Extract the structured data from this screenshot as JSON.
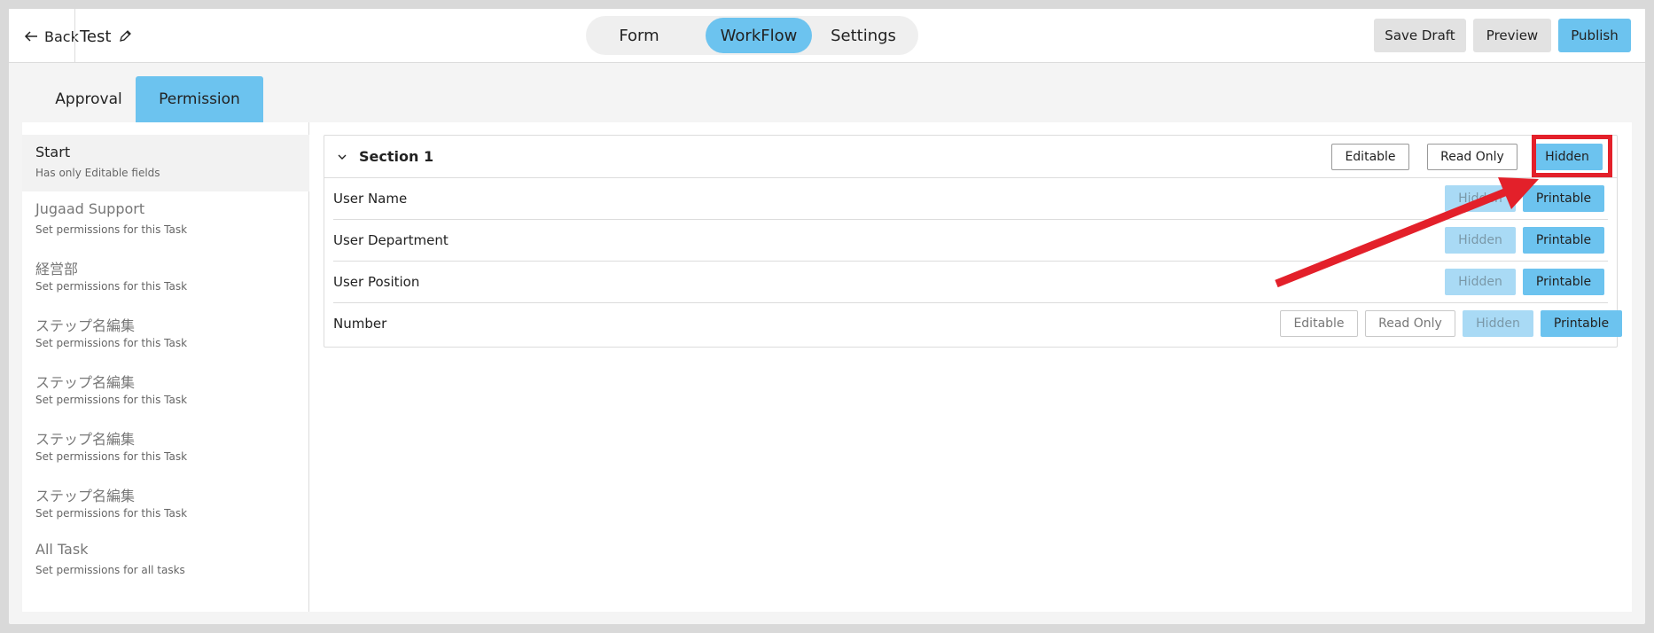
{
  "header": {
    "back_label": "Back",
    "title": "Test",
    "segments": [
      {
        "label": "Form"
      },
      {
        "label": "WorkFlow"
      },
      {
        "label": "Settings"
      }
    ],
    "save_draft_label": "Save Draft",
    "preview_label": "Preview",
    "publish_label": "Publish"
  },
  "tabs": [
    {
      "label": "Approval"
    },
    {
      "label": "Permission"
    }
  ],
  "sidebar": {
    "items": [
      {
        "title": "Start",
        "subtitle": "Has only Editable fields"
      },
      {
        "title": "Jugaad Support",
        "subtitle": "Set permissions for this Task"
      },
      {
        "title": "経営部",
        "subtitle": "Set permissions for this Task"
      },
      {
        "title": "ステップ名編集",
        "subtitle": "Set permissions for this Task"
      },
      {
        "title": "ステップ名編集",
        "subtitle": "Set permissions for this Task"
      },
      {
        "title": "ステップ名編集",
        "subtitle": "Set permissions for this Task"
      },
      {
        "title": "ステップ名編集",
        "subtitle": "Set permissions for this Task"
      },
      {
        "title": "All Task",
        "subtitle": "Set permissions for all tasks"
      }
    ]
  },
  "section": {
    "title": "Section 1",
    "editable_label": "Editable",
    "readonly_label": "Read Only",
    "hidden_label": "Hidden",
    "rows": [
      {
        "label": "User Name",
        "hidden_label": "Hidden",
        "printable_label": "Printable"
      },
      {
        "label": "User Department",
        "hidden_label": "Hidden",
        "printable_label": "Printable"
      },
      {
        "label": "User Position",
        "hidden_label": "Hidden",
        "printable_label": "Printable"
      },
      {
        "label": "Number",
        "editable_label": "Editable",
        "readonly_label": "Read Only",
        "hidden_label": "Hidden",
        "printable_label": "Printable"
      }
    ]
  },
  "colors": {
    "accent": "#6cc3ef",
    "accent_light": "#a9daf5",
    "annotation": "#e3202a"
  }
}
